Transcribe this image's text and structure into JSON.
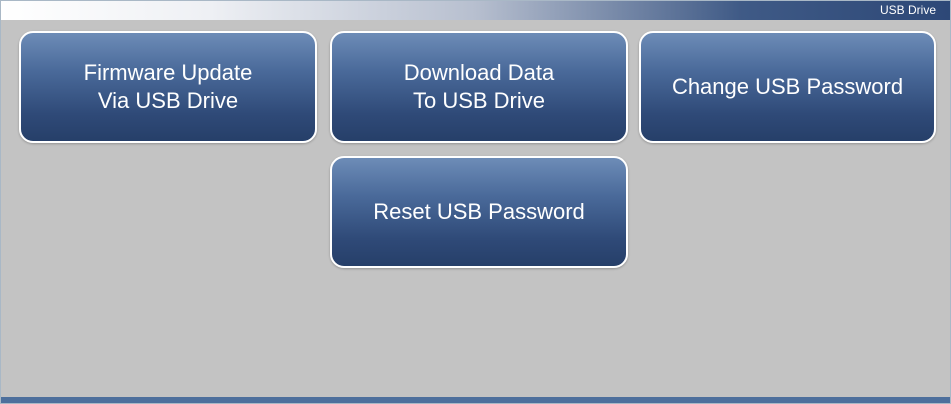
{
  "header": {
    "title": "USB Drive"
  },
  "buttons": {
    "firmware_update": {
      "line1": "Firmware Update",
      "line2": "Via USB Drive"
    },
    "download_data": {
      "line1": "Download Data",
      "line2": "To USB Drive"
    },
    "change_password": {
      "label": "Change USB Password"
    },
    "reset_password": {
      "label": "Reset USB Password"
    }
  },
  "colors": {
    "button_top": "#6d8cb7",
    "button_bottom": "#263f69",
    "background": "#c3c3c3",
    "accent_bar": "#4d6f9c"
  }
}
